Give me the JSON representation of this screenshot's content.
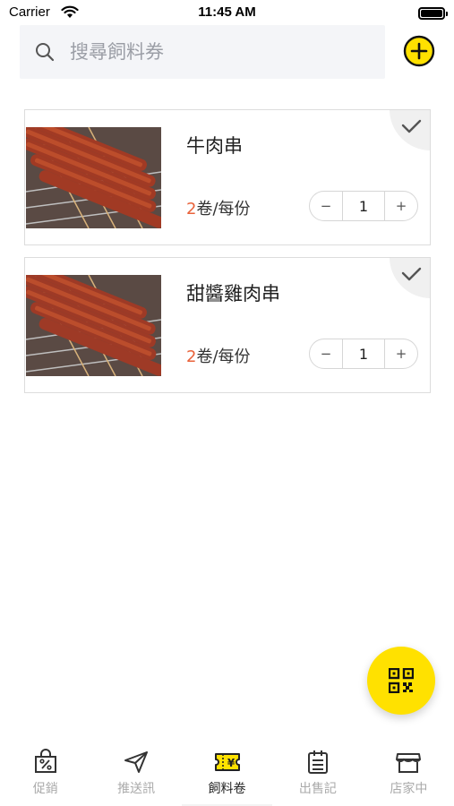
{
  "status_bar": {
    "carrier": "Carrier",
    "time": "11:45 AM"
  },
  "search": {
    "placeholder": "搜尋飼料券",
    "value": ""
  },
  "items": [
    {
      "name": "牛肉串",
      "price_number": "2",
      "price_unit": "卷/每份",
      "quantity": "1",
      "minus": "−",
      "plus": "+",
      "selected": true
    },
    {
      "name": "甜醬雞肉串",
      "price_number": "2",
      "price_unit": "卷/每份",
      "quantity": "1",
      "minus": "−",
      "plus": "+",
      "selected": true
    }
  ],
  "tabs": [
    {
      "label": "促銷",
      "icon": "discount-bag-icon",
      "active": false
    },
    {
      "label": "推送訊",
      "icon": "paper-plane-icon",
      "active": false
    },
    {
      "label": "飼料卷",
      "icon": "yen-ticket-icon",
      "active": true
    },
    {
      "label": "出售記",
      "icon": "clipboard-icon",
      "active": false
    },
    {
      "label": "店家中",
      "icon": "storefront-icon",
      "active": false
    }
  ],
  "colors": {
    "accent": "#ffe100",
    "price": "#e9623a",
    "search_bg": "#f4f5f8"
  }
}
